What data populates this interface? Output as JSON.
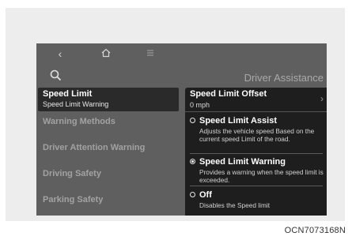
{
  "screen": {
    "title": "Driver Assistance",
    "nav": {
      "back": "‹",
      "home": "⌂",
      "menu": "≡"
    }
  },
  "menu": {
    "selected": {
      "label": "Speed Limit",
      "sublabel": "Speed Limit Warning"
    },
    "items": [
      {
        "label": "Warning Methods"
      },
      {
        "label": "Driver Attention Warning"
      },
      {
        "label": "Driving Safety"
      },
      {
        "label": "Parking Safety"
      }
    ]
  },
  "panel": {
    "offset": {
      "title": "Speed Limit Offset",
      "value": "0 mph",
      "chevron": "›"
    },
    "options": [
      {
        "title": "Speed Limit Assist",
        "desc": "Adjusts the vehicle speed Based on the current speed Limit of the road.",
        "checked": false
      },
      {
        "title": "Speed Limit Warning",
        "desc": "Provides a warning when the speed limit is exceeded.",
        "checked": true
      },
      {
        "title": "Off",
        "desc": "Disables the Speed limit",
        "checked": false
      }
    ]
  },
  "caption": "OCN7073168N"
}
